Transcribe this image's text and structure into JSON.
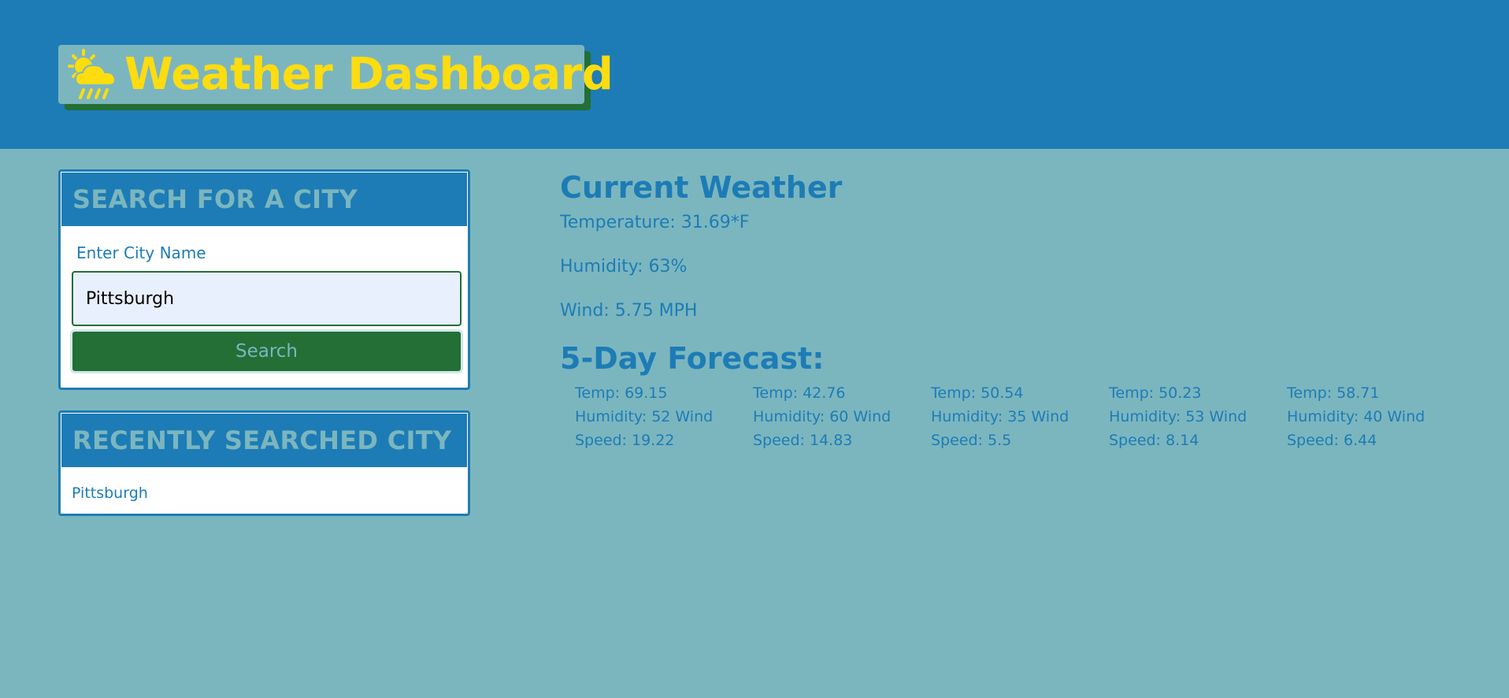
{
  "header": {
    "title": "Weather Dashboard",
    "icon": "sun-cloud-rain-icon"
  },
  "search": {
    "heading": "SEARCH FOR A CITY",
    "label": "Enter City Name",
    "input_value": "Pittsburgh",
    "button_label": "Search"
  },
  "recent": {
    "heading": "RECENTLY SEARCHED CITY",
    "items": [
      "Pittsburgh"
    ]
  },
  "current": {
    "heading": "Current Weather",
    "temperature": "Temperature: 31.69*F",
    "humidity": "Humidity: 63%",
    "wind": "Wind: 5.75 MPH"
  },
  "forecast": {
    "heading": "5-Day Forecast:",
    "days": [
      {
        "temp": "Temp: 69.15",
        "rest": "Humidity: 52 Wind Speed: 19.22"
      },
      {
        "temp": "Temp: 42.76",
        "rest": "Humidity: 60 Wind Speed: 14.83"
      },
      {
        "temp": "Temp: 50.54",
        "rest": "Humidity: 35 Wind Speed: 5.5"
      },
      {
        "temp": "Temp: 50.23",
        "rest": "Humidity: 53 Wind Speed: 8.14"
      },
      {
        "temp": "Temp: 58.71",
        "rest": "Humidity: 40 Wind Speed: 6.44"
      }
    ]
  },
  "colors": {
    "background": "#7bb6bf",
    "header": "#1d7cb5",
    "title_yellow": "#fddc10",
    "button_green": "#236f36"
  }
}
